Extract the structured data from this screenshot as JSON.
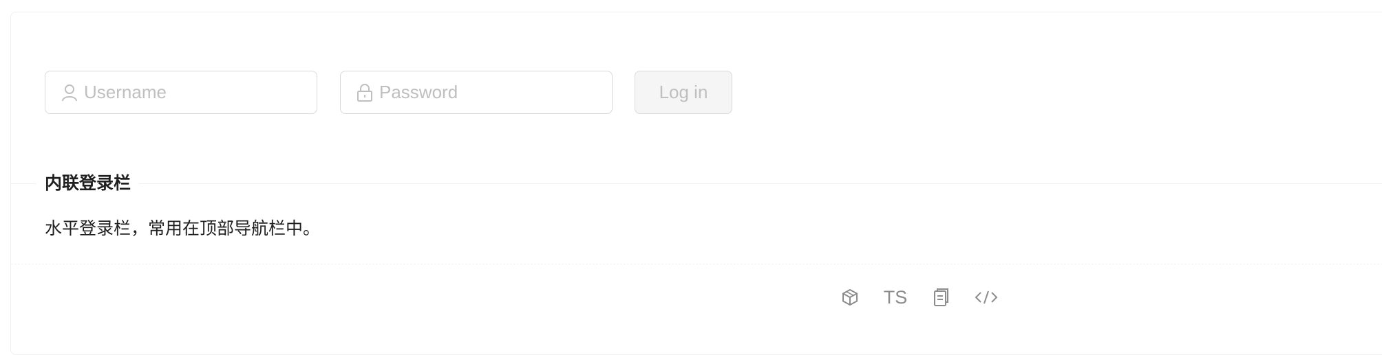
{
  "form": {
    "username_placeholder": "Username",
    "username_value": "",
    "username_icon": "user-icon",
    "password_placeholder": "Password",
    "password_value": "",
    "password_icon": "lock-icon",
    "submit_label": "Log in",
    "submit_disabled": true
  },
  "meta": {
    "title": "内联登录栏",
    "description": "水平登录栏，常用在顶部导航栏中。"
  },
  "actions": [
    {
      "icon": "codesandbox-icon"
    },
    {
      "label": "TS"
    },
    {
      "icon": "copy-icon"
    },
    {
      "icon": "code-icon"
    }
  ],
  "colors": {
    "border": "#d9d9d9",
    "placeholder": "#bfbfbf",
    "disabled_bg": "#f5f5f5",
    "text": "#000000",
    "icon_gray": "#8c8c8c"
  }
}
